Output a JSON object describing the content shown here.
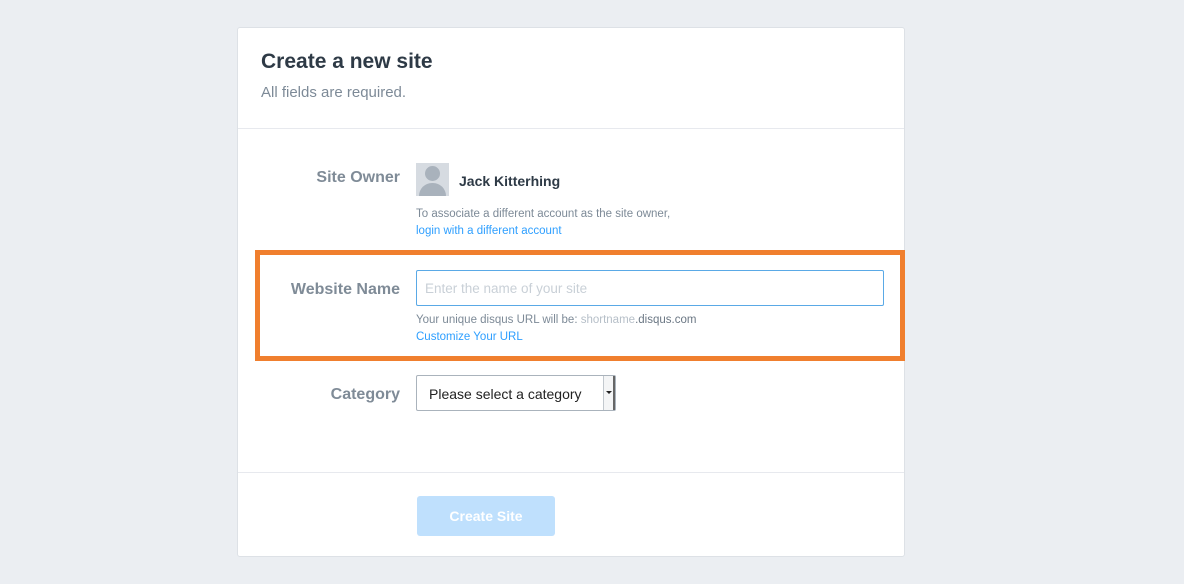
{
  "header": {
    "title": "Create a new site",
    "subtitle": "All fields are required."
  },
  "site_owner": {
    "label": "Site Owner",
    "name": "Jack Kitterhing",
    "help_text": "To associate a different account as the site owner,",
    "link_text": "login with a different account"
  },
  "website_name": {
    "label": "Website Name",
    "placeholder": "Enter the name of your site",
    "value": "",
    "url_prefix": "Your unique disqus URL will be: ",
    "url_shortname": "shortname",
    "url_suffix": ".disqus.com",
    "customize_link": "Customize Your URL"
  },
  "category": {
    "label": "Category",
    "selected": "Please select a category"
  },
  "actions": {
    "create_label": "Create Site"
  },
  "colors": {
    "highlight": "#f07f2e",
    "link": "#2e9fff",
    "button_disabled": "#bfe0fd"
  },
  "icons": {
    "avatar": "user-avatar-placeholder",
    "select_arrow": "caret-down-icon"
  }
}
